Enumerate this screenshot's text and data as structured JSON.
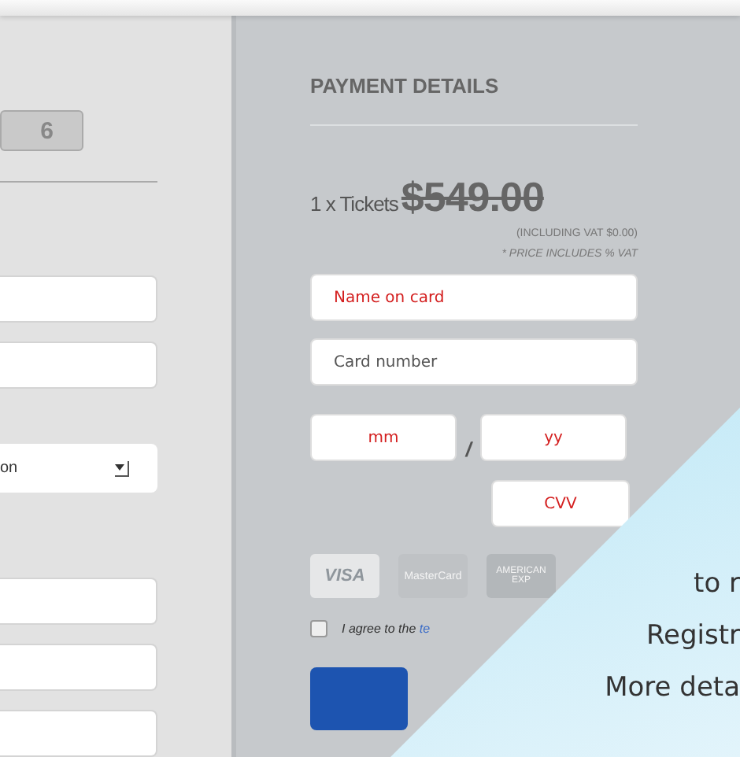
{
  "registration": {
    "quantity": "6",
    "select": {
      "value": "on"
    }
  },
  "payment": {
    "title": "PAYMENT DETAILS",
    "quantity_label": "1 x Tickets",
    "price": "$549.00",
    "vat_note": "(INCLUDING VAT $0.00)",
    "price_note": "* PRICE INCLUDES % VAT",
    "fields": [
      {
        "placeholder": "Name on card",
        "invalid": true
      },
      {
        "placeholder": "Card number",
        "invalid": false
      }
    ],
    "expiry": [
      {
        "placeholder": "mm",
        "invalid": true
      },
      {
        "placeholder": "yy",
        "invalid": true
      }
    ],
    "expiry_separator": "/",
    "cvv": {
      "placeholder": "CVV",
      "invalid": true
    },
    "cards": [
      {
        "kind": "visa",
        "lines": [
          "VISA"
        ]
      },
      {
        "kind": "mastercard",
        "lines": [
          "MasterCard"
        ]
      },
      {
        "kind": "amex",
        "lines": [
          "AMERICAN",
          "EXP"
        ]
      }
    ],
    "terms": {
      "checked": false,
      "text": "I agree to the",
      "link": "te"
    }
  },
  "banner": {
    "lines": [
      "to r",
      "Registr",
      "More deta"
    ]
  }
}
